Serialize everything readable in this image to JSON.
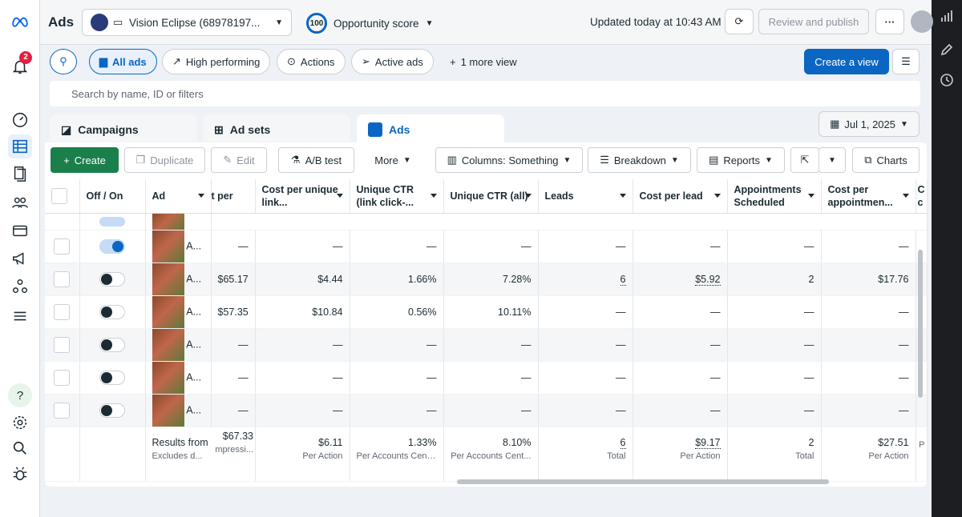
{
  "app": {
    "title": "Ads"
  },
  "account": {
    "name": "Vision Eclipse (68978197..."
  },
  "opportunity": {
    "score": "100",
    "label": "Opportunity score"
  },
  "header": {
    "updated": "Updated today at 10:43 AM",
    "review": "Review and publish"
  },
  "notifications": {
    "count": "2"
  },
  "filters": {
    "all_ads": "All ads",
    "high": "High performing",
    "actions": "Actions",
    "active": "Active ads",
    "more": "1 more view",
    "create_view": "Create a view"
  },
  "search": {
    "placeholder": "Search by name, ID or filters"
  },
  "tabs": {
    "campaigns": "Campaigns",
    "adsets": "Ad sets",
    "ads": "Ads"
  },
  "date": "Jul 1, 2025",
  "toolbar": {
    "create": "Create",
    "duplicate": "Duplicate",
    "edit": "Edit",
    "ab": "A/B test",
    "more": "More",
    "columns": "Columns: Something",
    "breakdown": "Breakdown",
    "reports": "Reports",
    "charts": "Charts"
  },
  "table": {
    "headers": [
      "Off / On",
      "Ad",
      "t per",
      "Cost per unique link...",
      "Unique CTR (link click-...",
      "Unique CTR (all)",
      "Leads",
      "Cost per lead",
      "Appointments Scheduled",
      "Cost per appointmen...",
      "C c"
    ],
    "rows": [
      {
        "ad": "A...",
        "vals": [
          "—",
          "—",
          "—",
          "—",
          "—",
          "—",
          "—",
          "—"
        ]
      },
      {
        "ad": "A...",
        "vals": [
          "$65.17",
          "$4.44",
          "1.66%",
          "7.28%",
          "6",
          "$5.92",
          "2",
          "$17.76"
        ]
      },
      {
        "ad": "A...",
        "vals": [
          "$57.35",
          "$10.84",
          "0.56%",
          "10.11%",
          "—",
          "—",
          "—",
          "—"
        ]
      },
      {
        "ad": "A...",
        "vals": [
          "—",
          "—",
          "—",
          "—",
          "—",
          "—",
          "—",
          "—"
        ]
      },
      {
        "ad": "A...",
        "vals": [
          "—",
          "—",
          "—",
          "—",
          "—",
          "—",
          "—",
          "—"
        ]
      },
      {
        "ad": "A...",
        "vals": [
          "—",
          "—",
          "—",
          "—",
          "—",
          "—",
          "—",
          "—"
        ]
      }
    ],
    "footer": {
      "label": "Results from",
      "sub": "Excludes d...",
      "cells": [
        {
          "v": "$67.33",
          "s": "mpressi..."
        },
        {
          "v": "$6.11",
          "s": "Per Action"
        },
        {
          "v": "1.33%",
          "s": "Per Accounts Cent..."
        },
        {
          "v": "8.10%",
          "s": "Per Accounts Cent..."
        },
        {
          "v": "6",
          "s": "Total"
        },
        {
          "v": "$9.17",
          "s": "Per Action"
        },
        {
          "v": "2",
          "s": "Total"
        },
        {
          "v": "$27.51",
          "s": "Per Action"
        },
        {
          "v": "",
          "s": "P"
        }
      ]
    }
  }
}
